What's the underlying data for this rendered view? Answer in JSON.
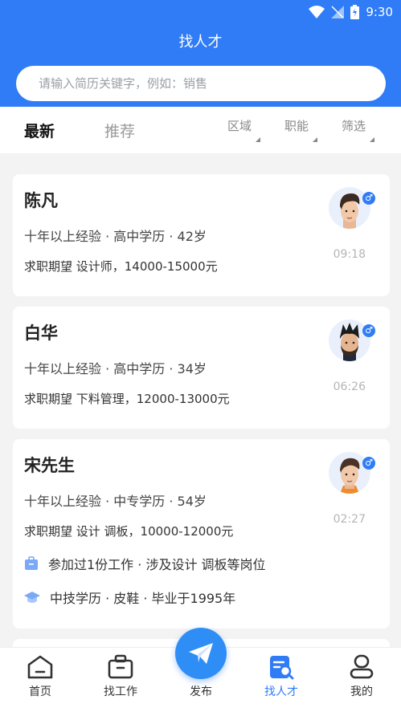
{
  "statusbar": {
    "time": "9:30"
  },
  "header": {
    "title": "找人才"
  },
  "search": {
    "placeholder": "请输入简历关键字，例如：销售"
  },
  "tabs": [
    {
      "label": "最新"
    },
    {
      "label": "推荐"
    }
  ],
  "filters": [
    {
      "label": "区域"
    },
    {
      "label": "职能"
    },
    {
      "label": "筛选"
    }
  ],
  "candidates": [
    {
      "name": "陈凡",
      "meta": "十年以上经验 · 高中学历 · 42岁",
      "expect": "求职期望 设计师，14000-15000元",
      "time": "09:18",
      "gender": "♂"
    },
    {
      "name": "白华",
      "meta": "十年以上经验 · 高中学历 · 34岁",
      "expect": "求职期望 下料管理，12000-13000元",
      "time": "06:26",
      "gender": "♂"
    },
    {
      "name": "宋先生",
      "meta": "十年以上经验 · 中专学历 · 54岁",
      "expect": "求职期望 设计 调板，10000-12000元",
      "time": "02:27",
      "gender": "♂",
      "work": "参加过1份工作 · 涉及设计 调板等岗位",
      "edu": "中技学历 · 皮鞋 · 毕业于1995年"
    }
  ],
  "bottom_nav": [
    {
      "label": "首页",
      "icon": "home-icon"
    },
    {
      "label": "找工作",
      "icon": "briefcase-icon"
    },
    {
      "label": "发布",
      "icon": "paper-plane-icon"
    },
    {
      "label": "找人才",
      "icon": "talent-search-icon"
    },
    {
      "label": "我的",
      "icon": "user-icon"
    }
  ],
  "colors": {
    "primary": "#2f7cf6",
    "background": "#f3f3f3"
  }
}
